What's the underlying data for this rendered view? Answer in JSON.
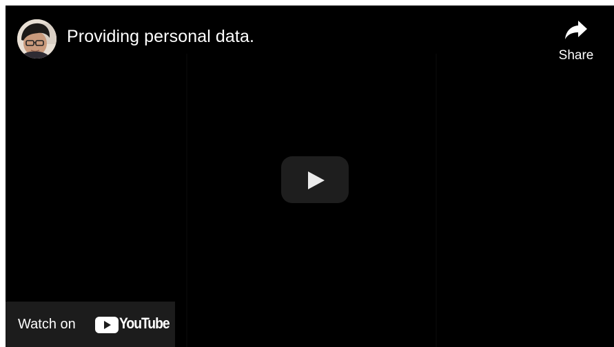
{
  "video": {
    "title": "Providing personal data."
  },
  "channel": {
    "avatar_icon": "channel-avatar-person"
  },
  "share": {
    "label": "Share",
    "icon": "share-arrow-icon"
  },
  "player": {
    "play_icon": "play-icon",
    "play_button_color": "#212121",
    "background_color": "#000000"
  },
  "watch_on": {
    "label": "Watch on",
    "brand": "YouTube",
    "brand_icon": "youtube-logo-icon",
    "brand_color": "#ff0000"
  }
}
